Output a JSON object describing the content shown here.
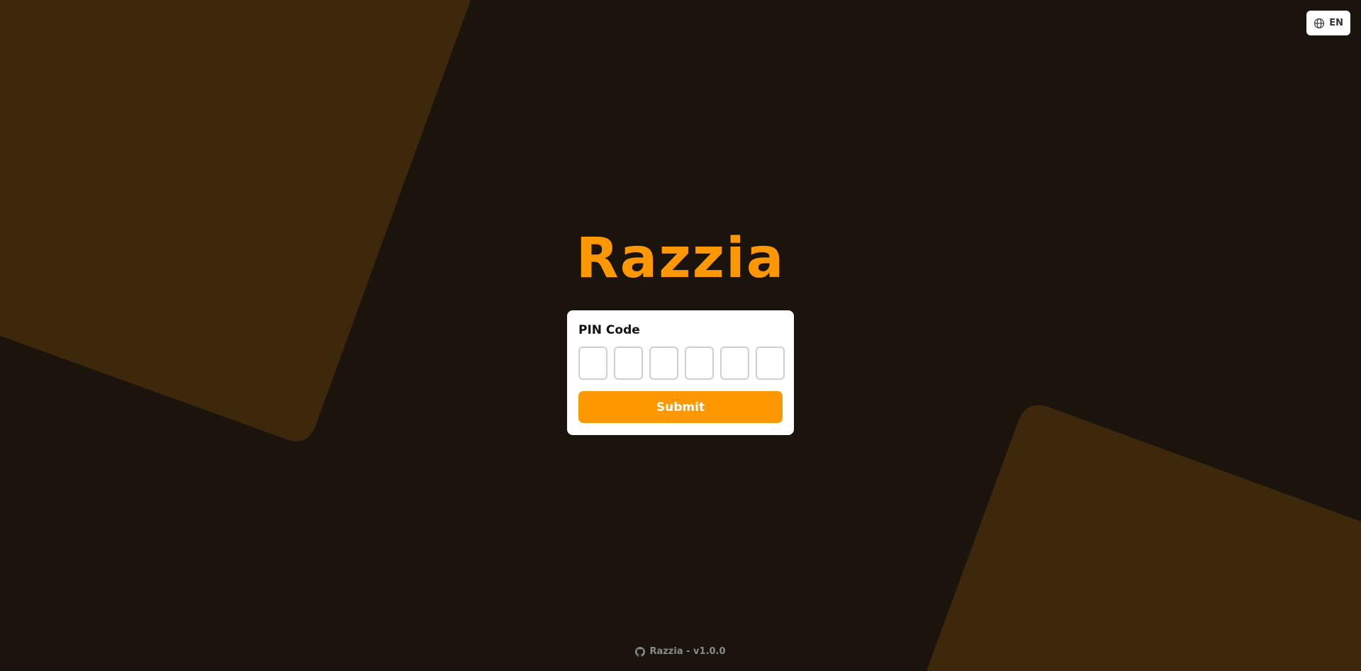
{
  "app": {
    "logo_text": "Razzia"
  },
  "language": {
    "icon": "globe-icon",
    "code": "EN"
  },
  "login": {
    "pin_label": "PIN Code",
    "pin_digits": [
      "",
      "",
      "",
      "",
      "",
      ""
    ],
    "submit_label": "Submit"
  },
  "footer": {
    "icon": "github-icon",
    "text": "Razzia - v1.0.0"
  },
  "colors": {
    "background": "#1a140c",
    "shape": "#3d280c",
    "accent": "#ff9800",
    "card": "#ffffff"
  }
}
